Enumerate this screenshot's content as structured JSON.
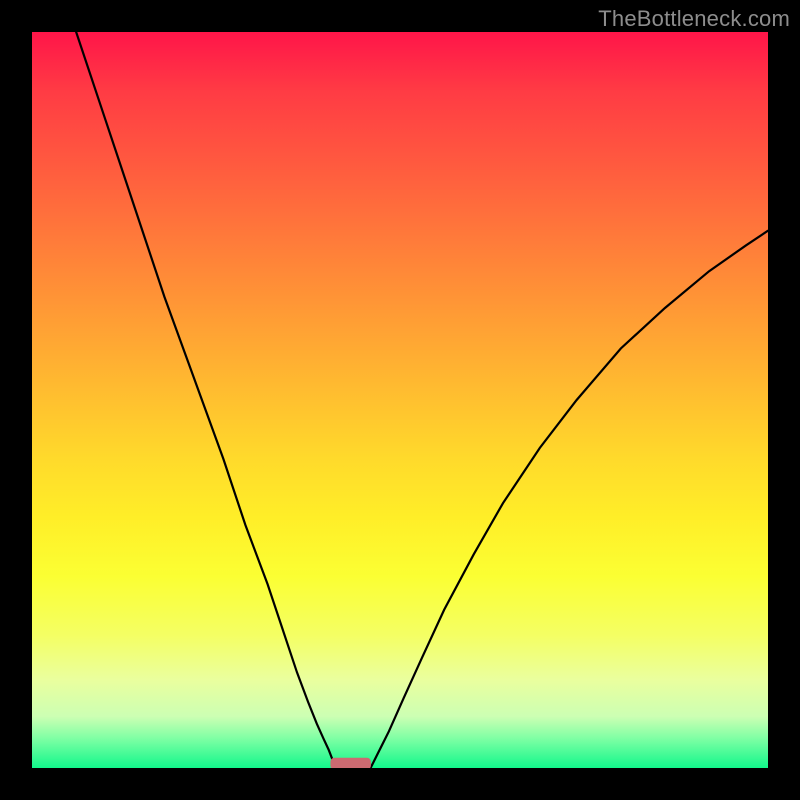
{
  "watermark": "TheBottleneck.com",
  "colors": {
    "frame_bg": "#000000",
    "curve_stroke": "#000000",
    "marker_fill": "#cc6a71",
    "gradient_stops": [
      "#ff1549",
      "#ff3b44",
      "#ff5a3f",
      "#ff7a3a",
      "#ff9a35",
      "#ffba30",
      "#ffda2b",
      "#ffee28",
      "#fbff33",
      "#f4ff64",
      "#eaff9e",
      "#ccffb3",
      "#7effa4",
      "#12f78b"
    ]
  },
  "chart_data": {
    "type": "line",
    "title": "",
    "xlabel": "",
    "ylabel": "",
    "xlim": [
      0,
      100
    ],
    "ylim": [
      0,
      100
    ],
    "grid": false,
    "legend": false,
    "series": [
      {
        "name": "left-curve",
        "x": [
          6,
          10,
          14,
          18,
          22,
          26,
          29,
          32,
          34,
          36,
          37.5,
          38.7,
          39.6,
          40.3,
          40.8,
          41.5
        ],
        "y": [
          100,
          88,
          76,
          64,
          53,
          42,
          33,
          25,
          19,
          13,
          9,
          6,
          4,
          2.5,
          1.2,
          0
        ]
      },
      {
        "name": "right-curve",
        "x": [
          46,
          47,
          48.5,
          50.5,
          53,
          56,
          60,
          64,
          69,
          74,
          80,
          86,
          92,
          97,
          100
        ],
        "y": [
          0,
          2,
          5,
          9.5,
          15,
          21.5,
          29,
          36,
          43.5,
          50,
          57,
          62.5,
          67.5,
          71,
          73
        ]
      }
    ],
    "marker": {
      "x_center": 43.3,
      "y": 0.6,
      "width": 5.5,
      "height": 1.6
    }
  }
}
